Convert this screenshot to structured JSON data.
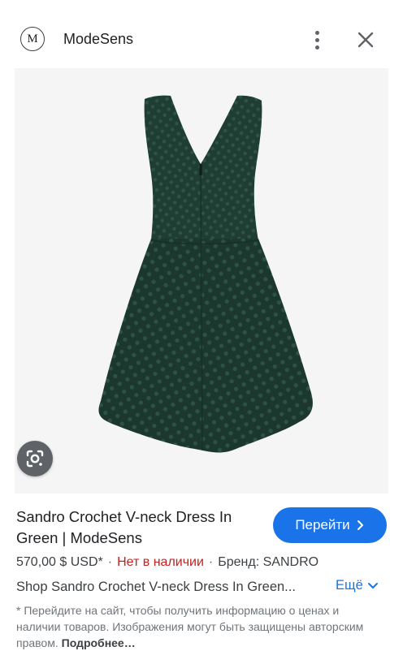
{
  "header": {
    "logo_letter": "M",
    "site_name": "ModeSens",
    "menu_icon": "more-vert-icon",
    "close_icon": "close-icon"
  },
  "image": {
    "subject": "dark green crochet V-neck sleeveless dress, back view",
    "dress_color": "#1f3d33",
    "background_color": "#f5f5f5",
    "lens_icon": "google-lens-icon"
  },
  "result": {
    "title": "Sandro Crochet V-neck Dress In Green | ModeSens",
    "go_button_label": "Перейти",
    "go_button_icon": "chevron-right-icon",
    "price": "570,00 $ USD*",
    "availability": "Нет в наличии",
    "brand": "Бренд: SANDRO",
    "separator": "·",
    "description": "Shop Sandro Crochet V-neck Dress In Green...",
    "more_label": "Ещё",
    "more_icon": "chevron-down-icon",
    "disclaimer": "* Перейдите на сайт, чтобы получить информацию о ценах и наличии товаров. Изображения могут быть защищены авторским правом.",
    "disclaimer_link": "Подробнее…"
  },
  "colors": {
    "accent": "#1a73e8",
    "out_of_stock": "#c5221f"
  }
}
